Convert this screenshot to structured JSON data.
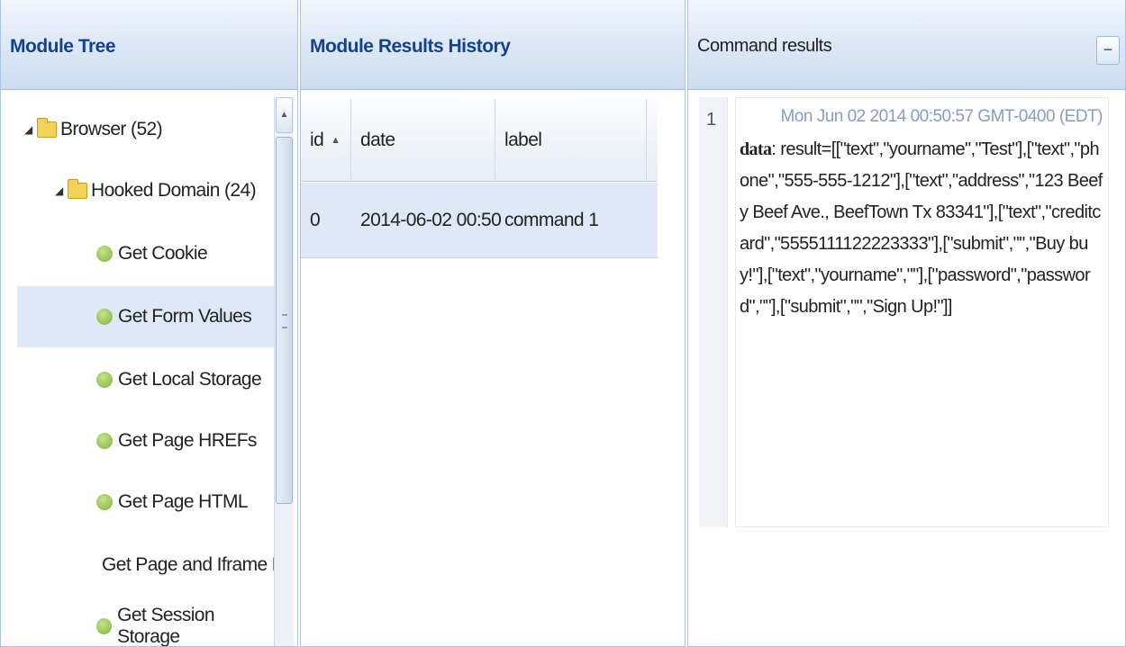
{
  "module_tree": {
    "title": "Module Tree",
    "nodes": [
      {
        "label": "Browser (52)",
        "type": "folder",
        "level": 0
      },
      {
        "label": "Hooked Domain (24)",
        "type": "folder",
        "level": 1
      },
      {
        "label": "Get Cookie",
        "type": "leaf",
        "level": 2
      },
      {
        "label": "Get Form Values",
        "type": "leaf",
        "level": 2,
        "selected": true
      },
      {
        "label": "Get Local Storage",
        "type": "leaf",
        "level": 2
      },
      {
        "label": "Get Page HREFs",
        "type": "leaf",
        "level": 2
      },
      {
        "label": "Get Page HTML",
        "type": "leaf",
        "level": 2
      },
      {
        "label": "Get Page and Iframe H",
        "type": "leaf",
        "level": 2
      },
      {
        "label": "Get Session Storage",
        "type": "leaf",
        "level": 2
      }
    ]
  },
  "history": {
    "title": "Module Results History",
    "columns": [
      "id",
      "date",
      "label"
    ],
    "sort_arrow": "▲",
    "rows": [
      {
        "id": "0",
        "date": "2014-06-02 00:50",
        "label": "command 1"
      }
    ]
  },
  "command_results": {
    "title": "Command results",
    "collapse_label": "−",
    "line_number": "1",
    "timestamp": "Mon Jun 02 2014 00:50:57 GMT-0400 (EDT)",
    "data_key": "data",
    "data_value": ": result=[[\"text\",\"yourname\",\"Test\"],[\"text\",\"phone\",\"555-555-1212\"],[\"text\",\"address\",\"123 Beefy Beef Ave., BeefTown Tx 83341\"],[\"text\",\"creditcard\",\"5555111122223333\"],[\"submit\",\"\",\"Buy buy!\"],[\"text\",\"yourname\",\"\"],[\"password\",\"password\",\"\"],[\"submit\",\"\",\"Sign Up!\"]]"
  }
}
